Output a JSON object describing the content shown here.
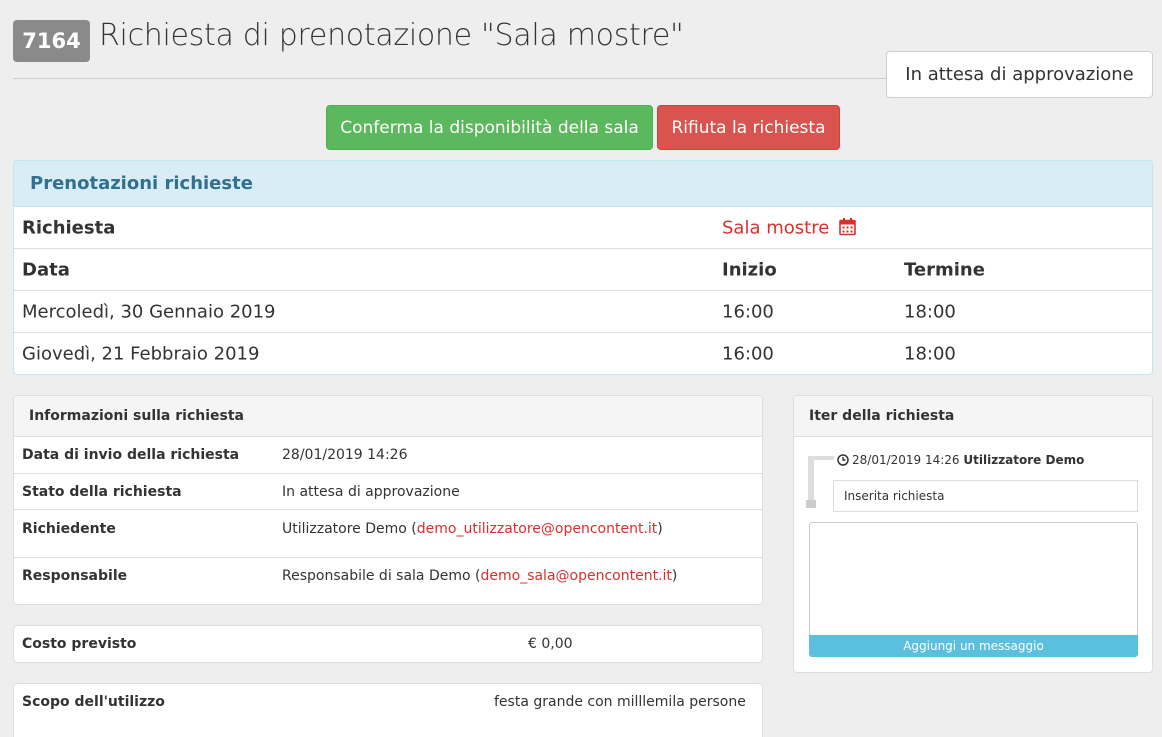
{
  "header": {
    "id_badge": "7164",
    "title": "Richiesta di prenotazione \"Sala mostre\"",
    "status": "In attesa di approvazione"
  },
  "actions": {
    "confirm_label": "Conferma la disponibilità della sala",
    "reject_label": "Rifiuta la richiesta"
  },
  "bookings": {
    "title": "Prenotazioni richieste",
    "request_label": "Richiesta",
    "room_link": "Sala mostre",
    "columns": {
      "date": "Data",
      "start": "Inizio",
      "end": "Termine"
    },
    "rows": [
      {
        "date": "Mercoledì, 30 Gennaio 2019",
        "start": "16:00",
        "end": "18:00"
      },
      {
        "date": "Giovedì, 21 Febbraio 2019",
        "start": "16:00",
        "end": "18:00"
      }
    ]
  },
  "info": {
    "title": "Informazioni sulla richiesta",
    "rows": [
      {
        "label": "Data di invio della richiesta",
        "value": "28/01/2019 14:26"
      },
      {
        "label": "Stato della richiesta",
        "value": "In attesa di approvazione"
      },
      {
        "label": "Richiedente",
        "name": "Utilizzatore Demo",
        "email": "demo_utilizzatore@opencontent.it"
      },
      {
        "label": "Responsabile",
        "name": "Responsabile di sala Demo",
        "email": "demo_sala@opencontent.it"
      }
    ]
  },
  "cost": {
    "label": "Costo previsto",
    "value": "€ 0,00"
  },
  "scope": {
    "label": "Scopo dell'utilizzo",
    "value": "festa grande con milllemila persone"
  },
  "iter": {
    "title": "Iter della richiesta",
    "entry": {
      "timestamp": "28/01/2019 14:26",
      "user": "Utilizzatore Demo",
      "message": "Inserita richiesta"
    },
    "add_message_label": "Aggiungi un messaggio"
  },
  "icons": {
    "calendar": "calendar-icon",
    "clock": "clock-icon"
  },
  "colors": {
    "success": "#5cb85c",
    "danger": "#d9534f",
    "info": "#5bc0de",
    "link": "#d9302b",
    "panel_heading": "#31708f"
  }
}
